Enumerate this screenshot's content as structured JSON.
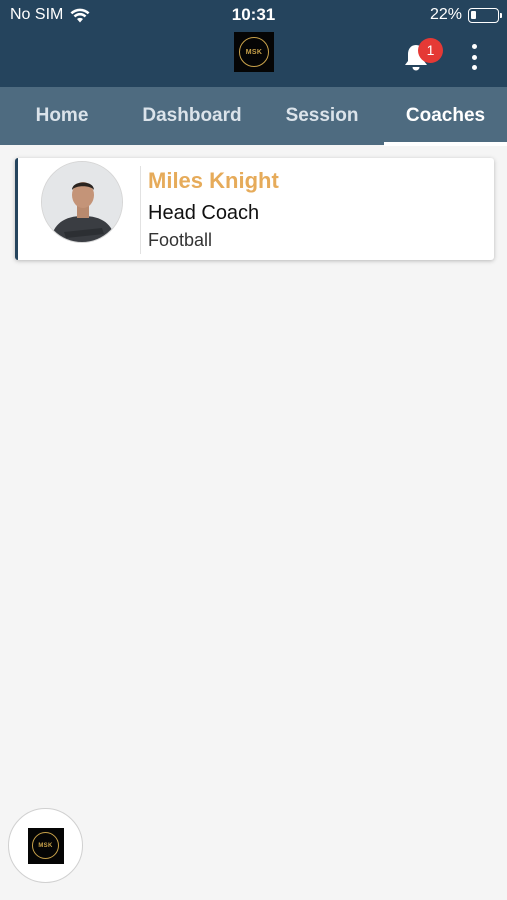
{
  "status_bar": {
    "carrier": "No SIM",
    "time": "10:31",
    "battery_percent": "22%",
    "battery_level": 0.22
  },
  "header": {
    "logo_text": "MSK",
    "notification_count": "1",
    "icons": [
      "bell-icon",
      "more-vertical-icon"
    ]
  },
  "tabs": [
    {
      "label": "Home",
      "active": false
    },
    {
      "label": "Dashboard",
      "active": false
    },
    {
      "label": "Session",
      "active": false
    },
    {
      "label": "Coaches",
      "active": true
    }
  ],
  "coaches": [
    {
      "name": "Miles Knight",
      "role": "Head Coach",
      "sport": "Football"
    }
  ],
  "fab": {
    "logo_text": "MSK"
  },
  "colors": {
    "header_bg": "#25445d",
    "tabs_bg": "#4e6b80",
    "accent_gold": "#e6ab5a",
    "badge_red": "#e53935",
    "page_bg": "#f5f5f5"
  }
}
